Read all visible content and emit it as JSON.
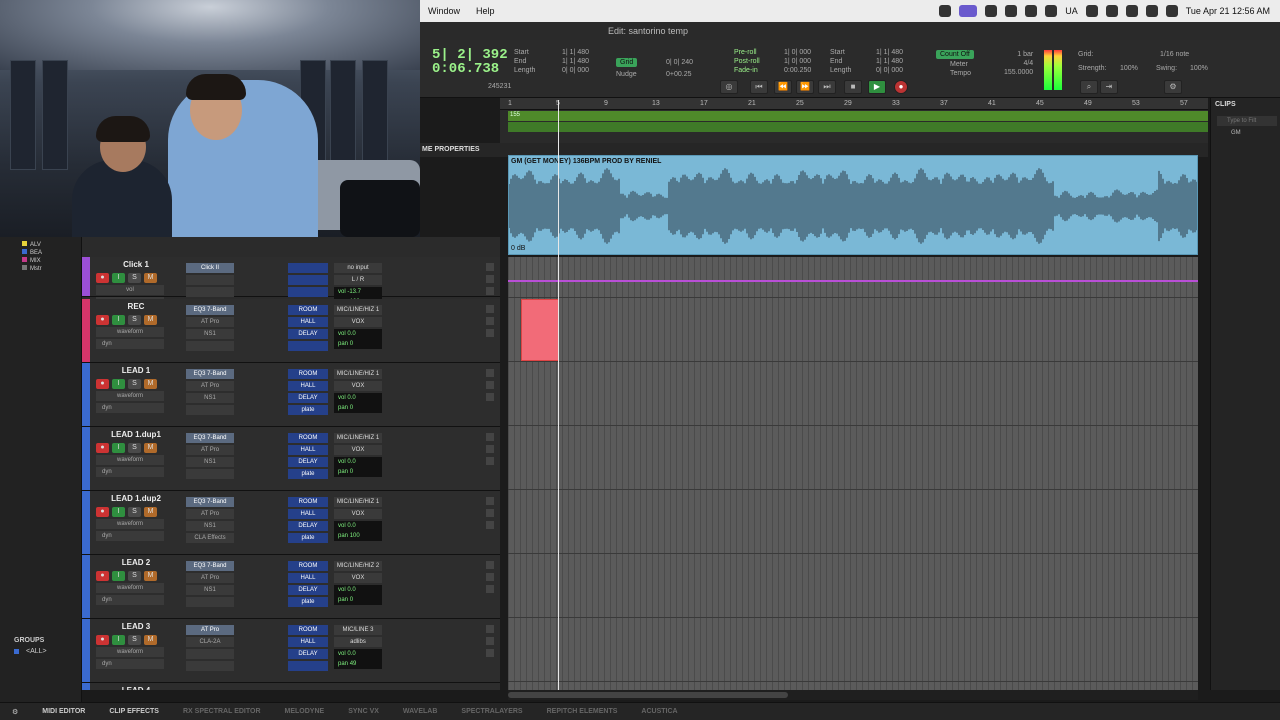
{
  "menubar": {
    "items": [
      "Window",
      "Help"
    ],
    "tray_text": "UA",
    "datetime": "Tue Apr 21  12:56 AM"
  },
  "window": {
    "title": "Edit: santorino temp"
  },
  "toolbar": {
    "counter_main": "5| 2| 392",
    "counter_sub": "0:06.738",
    "start_label": "Start",
    "end_label": "End",
    "length_label": "Length",
    "start_val": "1| 1| 480",
    "end_val": "1| 1| 480",
    "length_val": "0| 0| 000",
    "samples": "245231",
    "grid_label": "Grid",
    "nudge_label": "Nudge",
    "grid_val": "0| 0| 240",
    "nudge_val": "0+00.25",
    "preroll_label": "Pre-roll",
    "postroll_label": "Post-roll",
    "fadein_label": "Fade-in",
    "preroll_val": "1| 0| 000",
    "postroll_val": "1| 0| 000",
    "fadein_val": "0:00.250",
    "start2_val": "1| 1| 480",
    "end2_val": "1| 1| 480",
    "length2_val": "0| 0| 000",
    "countoff_label": "Count Off",
    "meter_label": "Meter",
    "tempo_label": "Tempo",
    "countoff_val": "1 bar",
    "meter_val": "4/4",
    "tempo_val": "155.0000",
    "grid_right_label": "Grid:",
    "grid_right_val": "1/16 note",
    "strength_label": "Strength:",
    "strength_val": "100%",
    "swing_label": "Swing:",
    "swing_val": "100%"
  },
  "ruler": {
    "bars": [
      "1",
      "5",
      "9",
      "13",
      "17",
      "21",
      "25",
      "29",
      "33",
      "37",
      "41",
      "45",
      "49",
      "53",
      "57"
    ],
    "tempo_marker": "155"
  },
  "clip_header": {
    "label": "ME PROPERTIES"
  },
  "audio_clip": {
    "name": "GM (GET MONEY) 136BPM PROD BY RENIEL",
    "gain": "0 dB",
    "color": "#7ab8d6"
  },
  "left_panel": {
    "color_legend": [
      "ALV",
      "BEA",
      "MIX",
      "Mstr"
    ],
    "groups_title": "GROUPS",
    "groups_all": "<ALL>"
  },
  "tracks": [
    {
      "name": "Click 1",
      "color": "#9b4fd6",
      "line2": "vol",
      "line3": "",
      "insert1": "Click II",
      "insert2": "",
      "insert3": "",
      "insert4": "",
      "send_a": "",
      "send_b": "",
      "send_c": "",
      "send_d": "",
      "io_in": "no input",
      "io_out": "L / R",
      "vol": "-13.7",
      "pan": "100"
    },
    {
      "name": "REC",
      "color": "#d6356a",
      "line2": "waveform",
      "line3": "dyn",
      "insert1": "EQ3 7-Band",
      "insert2": "AT Pro",
      "insert3": "NS1",
      "insert4": "",
      "send_a": "ROOM",
      "send_b": "HALL",
      "send_c": "DELAY",
      "send_d": "",
      "io_in": "MIC/LINE/HIZ 1",
      "io_out": "VOX",
      "vol": "0.0",
      "pan": "0"
    },
    {
      "name": "LEAD 1",
      "color": "#3a6ad0",
      "line2": "waveform",
      "line3": "dyn",
      "insert1": "EQ3 7-Band",
      "insert2": "AT Pro",
      "insert3": "NS1",
      "insert4": "",
      "send_a": "ROOM",
      "send_b": "HALL",
      "send_c": "DELAY",
      "send_d": "plate",
      "io_in": "MIC/LINE/HIZ 1",
      "io_out": "VOX",
      "vol": "0.0",
      "pan": "0"
    },
    {
      "name": "LEAD 1.dup1",
      "color": "#3a6ad0",
      "line2": "waveform",
      "line3": "dyn",
      "insert1": "EQ3 7-Band",
      "insert2": "AT Pro",
      "insert3": "NS1",
      "insert4": "",
      "send_a": "ROOM",
      "send_b": "HALL",
      "send_c": "DELAY",
      "send_d": "plate",
      "io_in": "MIC/LINE/HIZ 1",
      "io_out": "VOX",
      "vol": "0.0",
      "pan": "0"
    },
    {
      "name": "LEAD 1.dup2",
      "color": "#3a6ad0",
      "line2": "waveform",
      "line3": "dyn",
      "insert1": "EQ3 7-Band",
      "insert2": "AT Pro",
      "insert3": "NS1",
      "insert4": "CLA Effects",
      "send_a": "ROOM",
      "send_b": "HALL",
      "send_c": "DELAY",
      "send_d": "plate",
      "io_in": "MIC/LINE/HIZ 1",
      "io_out": "VOX",
      "vol": "0.0",
      "pan": "100"
    },
    {
      "name": "LEAD 2",
      "color": "#3a6ad0",
      "line2": "waveform",
      "line3": "dyn",
      "insert1": "EQ3 7-Band",
      "insert2": "AT Pro",
      "insert3": "NS1",
      "insert4": "",
      "send_a": "ROOM",
      "send_b": "HALL",
      "send_c": "DELAY",
      "send_d": "plate",
      "io_in": "MIC/LINE/HIZ 2",
      "io_out": "VOX",
      "vol": "0.0",
      "pan": "0"
    },
    {
      "name": "LEAD 3",
      "color": "#3a6ad0",
      "line2": "waveform",
      "line3": "dyn",
      "insert1": "AT Pro",
      "insert2": "CLA-2A",
      "insert3": "",
      "insert4": "",
      "send_a": "ROOM",
      "send_b": "HALL",
      "send_c": "DELAY",
      "send_d": "",
      "io_in": "MIC/LINE 3",
      "io_out": "adlibs",
      "vol": "0.0",
      "pan": "49"
    }
  ],
  "partial_track": {
    "name": "LEAD 4"
  },
  "clips_panel": {
    "title": "CLIPS",
    "search_placeholder": "Type to Filt",
    "item": "GM"
  },
  "bottom_bar": {
    "tabs": [
      "MIDI EDITOR",
      "CLIP EFFECTS",
      "RX SPECTRAL EDITOR",
      "MELODYNE",
      "SYNC VX",
      "WAVELAB",
      "SPECTRALAYERS",
      "REPITCH ELEMENTS",
      "ACUSTICA"
    ],
    "active": [
      true,
      true,
      false,
      false,
      false,
      false,
      false,
      false,
      false
    ]
  }
}
